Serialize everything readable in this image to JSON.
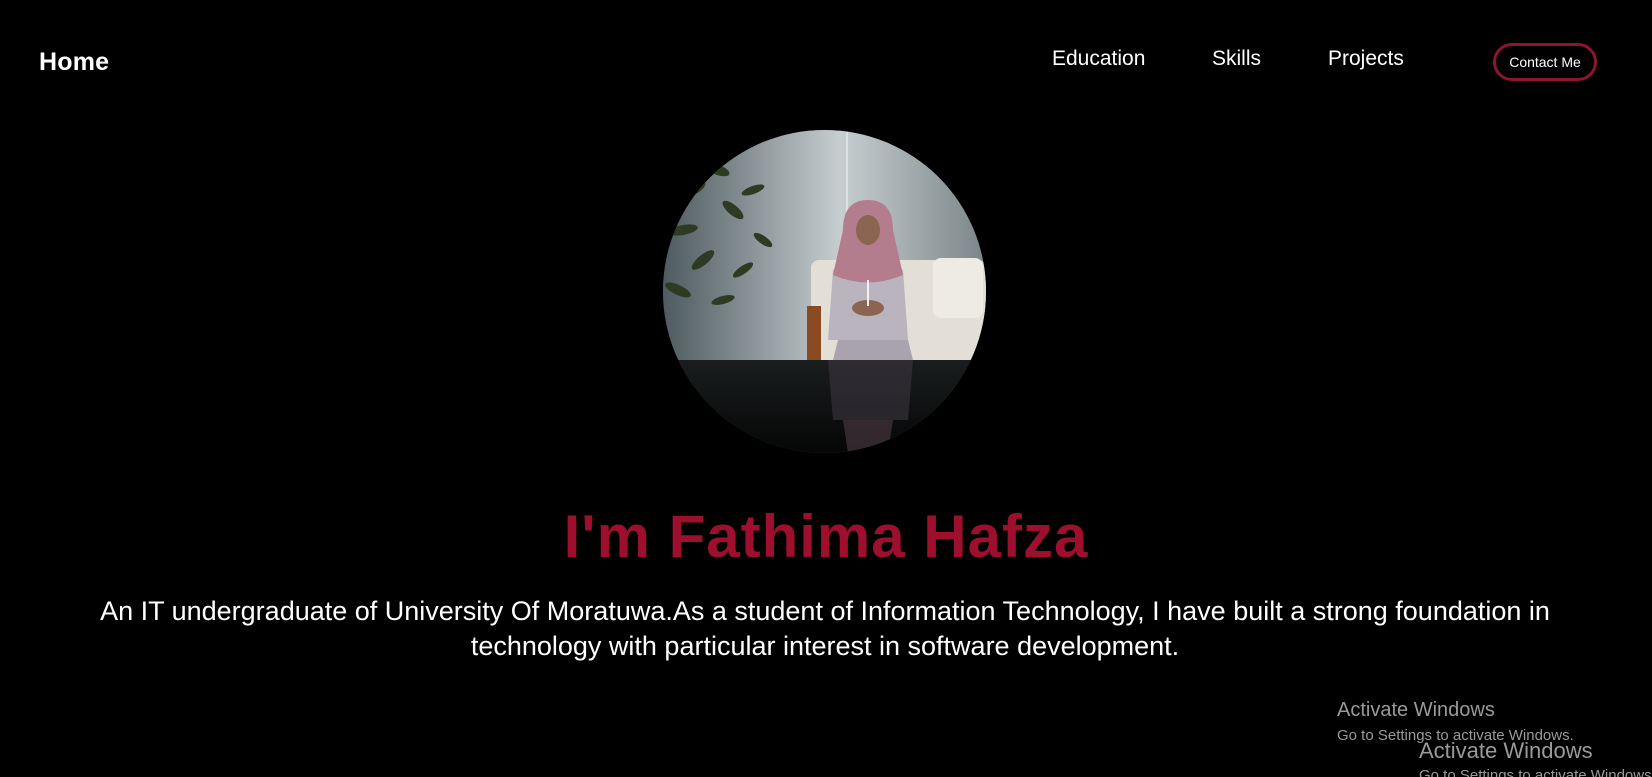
{
  "nav": {
    "home_label": "Home",
    "links": [
      {
        "label": "Education"
      },
      {
        "label": "Skills"
      },
      {
        "label": "Projects"
      }
    ],
    "contact_label": "Contact Me"
  },
  "hero": {
    "name": "I'm Fathima Hafza",
    "description": "An IT undergraduate of University Of Moratuwa.As a student of Information Technology, I have built a strong foundation in technology with particular interest in software development."
  },
  "watermark": {
    "title": "Activate Windows",
    "subtitle": "Go to Settings to activate Windows.",
    "title_2": "Activate Windows",
    "subtitle_2": "Go to Settings to activate Windows."
  },
  "colors": {
    "background": "#000000",
    "accent": "#9e0f2d",
    "button_border": "#8e1532",
    "text": "#ffffff"
  }
}
